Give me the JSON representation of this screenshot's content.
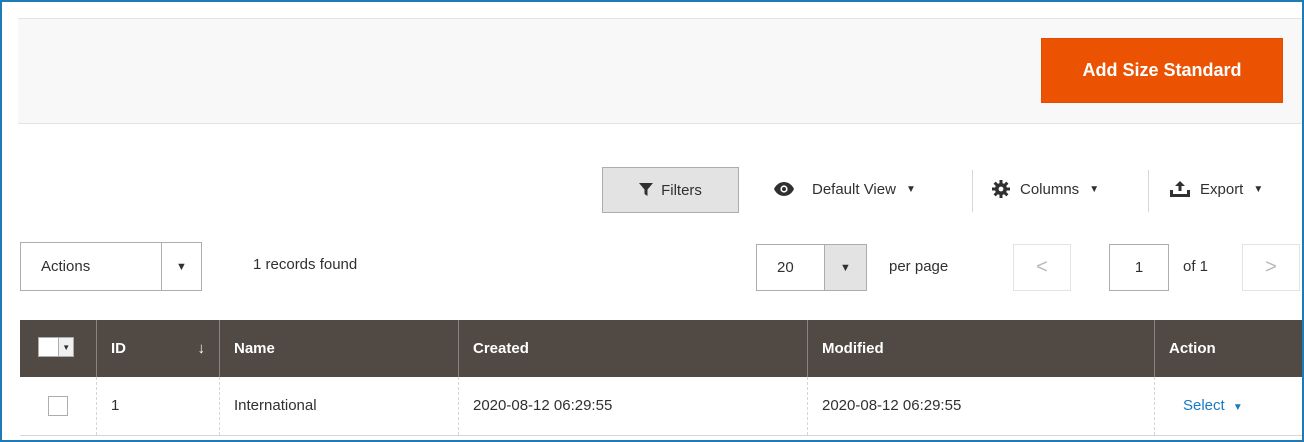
{
  "page_actions": {
    "add_button": "Add Size Standard"
  },
  "toolbar": {
    "filters_label": "Filters",
    "default_view_label": "Default View",
    "columns_label": "Columns",
    "export_label": "Export"
  },
  "grid_controls": {
    "actions_label": "Actions",
    "records_found": "1 records found",
    "per_page_value": "20",
    "per_page_label": "per page",
    "current_page": "1",
    "of_pages": "of 1",
    "prev_symbol": "<",
    "next_symbol": ">"
  },
  "table": {
    "columns": [
      "ID",
      "Name",
      "Created",
      "Modified",
      "Action"
    ],
    "sort_symbol": "↓",
    "rows": [
      {
        "id": "1",
        "name": "International",
        "created": "2020-08-12 06:29:55",
        "modified": "2020-08-12 06:29:55",
        "action": "Select"
      }
    ]
  },
  "colors": {
    "accent": "#eb5202",
    "header_bg": "#514943",
    "link": "#1979c3",
    "frame": "#1e7bb6"
  }
}
